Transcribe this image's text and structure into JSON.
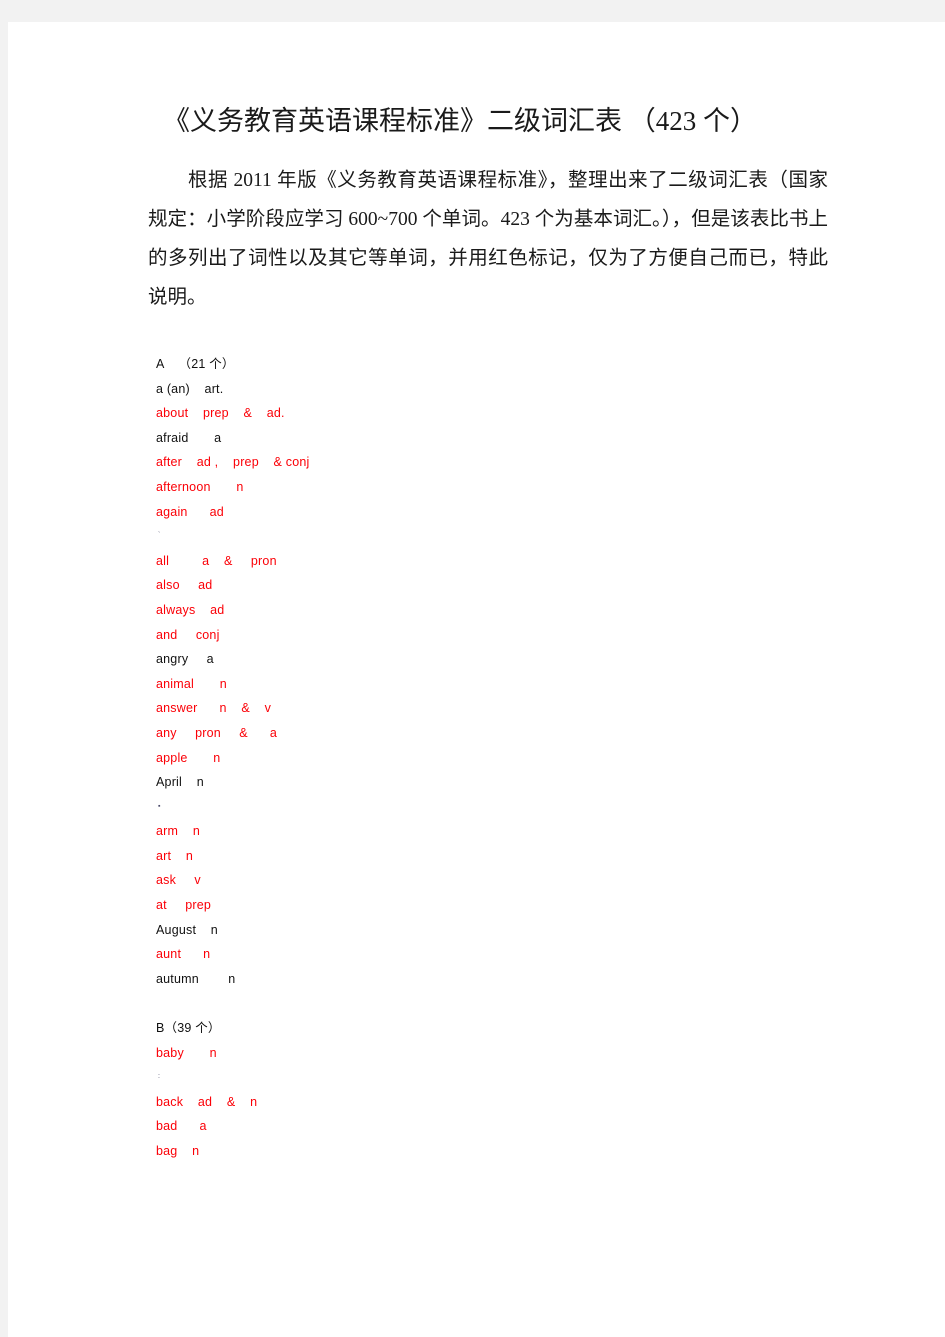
{
  "document": {
    "title_cn_open": "《义务教育英语课程标准》二级词汇表 （",
    "title_count": "423",
    "title_cn_close": " 个）",
    "title_full": "《义务教育英语课程标准》二级词汇表 （423 个）",
    "intro_paragraph": "根据 2011 年版《义务教育英语课程标准》，整理出来了二级词汇表（国家规定：小学阶段应学习 600~700 个单词。423 个为基本词汇。），但是该表比书上的多列出了词性以及其它等单词，并用红色标记，仅为了方便自己而已，特此说明。",
    "intro_segments": {
      "s1": "根据 ",
      "n1": "2011",
      "s2": " 年版《义务教育英语课程标准》，整理出来了二级词汇表（国家规定：小学阶段应学习 ",
      "n2": "600~700",
      "s3": " 个单词。",
      "n3": "423",
      "s4": " 个为基本词汇。），但是该表比书上的多列出了词性以及其它等单词，并用红色标记，仅为了方便自己而已，特此说明。"
    }
  },
  "colors": {
    "page_background": "#ffffff",
    "canvas_background": "#f2f2f2",
    "text_black": "#111111",
    "text_red": "#fb0007",
    "title_color": "#1a1a1a"
  },
  "sections": [
    {
      "id": "A",
      "heading": "A    （21 个）",
      "letter": "A",
      "count": "21",
      "entries": [
        {
          "text": "a (an)    art.",
          "word": "a (an)",
          "pos": "art.",
          "color": "black"
        },
        {
          "text": "about    prep    &    ad.",
          "word": "about",
          "pos": "prep  &  ad.",
          "color": "red"
        },
        {
          "text": "afraid       a",
          "word": "afraid",
          "pos": "a",
          "color": "black"
        },
        {
          "text": "after    ad ,    prep    & conj",
          "word": "after",
          "pos": "ad , prep & conj",
          "color": "red"
        },
        {
          "text": "afternoon       n",
          "word": "afternoon",
          "pos": "n",
          "color": "red"
        },
        {
          "text": "again      ad",
          "word": "again",
          "pos": "ad",
          "color": "red"
        },
        {
          "text": "`",
          "word": "",
          "pos": "",
          "color": "artifact"
        },
        {
          "text": "all         a    &     pron",
          "word": "all",
          "pos": "a & pron",
          "color": "red"
        },
        {
          "text": "also     ad",
          "word": "also",
          "pos": "ad",
          "color": "red"
        },
        {
          "text": "always    ad",
          "word": "always",
          "pos": "ad",
          "color": "red"
        },
        {
          "text": "and     conj",
          "word": "and",
          "pos": "conj",
          "color": "red"
        },
        {
          "text": "angry     a",
          "word": "angry",
          "pos": "a",
          "color": "black"
        },
        {
          "text": "animal       n",
          "word": "animal",
          "pos": "n",
          "color": "red"
        },
        {
          "text": "answer      n    &    v",
          "word": "answer",
          "pos": "n & v",
          "color": "red"
        },
        {
          "text": "any     pron     &      a",
          "word": "any",
          "pos": "pron & a",
          "color": "red"
        },
        {
          "text": "apple       n",
          "word": "apple",
          "pos": "n",
          "color": "red"
        },
        {
          "text": "April    n",
          "word": "April",
          "pos": "n",
          "color": "black"
        },
        {
          "text": "▪",
          "word": "",
          "pos": "",
          "color": "artifact"
        },
        {
          "text": "arm    n",
          "word": "arm",
          "pos": "n",
          "color": "red"
        },
        {
          "text": "art    n",
          "word": "art",
          "pos": "n",
          "color": "red"
        },
        {
          "text": "ask     v",
          "word": "ask",
          "pos": "v",
          "color": "red"
        },
        {
          "text": "at     prep",
          "word": "at",
          "pos": "prep",
          "color": "red"
        },
        {
          "text": "August    n",
          "word": "August",
          "pos": "n",
          "color": "black"
        },
        {
          "text": "aunt      n",
          "word": "aunt",
          "pos": "n",
          "color": "red"
        },
        {
          "text": "autumn        n",
          "word": "autumn",
          "pos": "n",
          "color": "black"
        }
      ]
    },
    {
      "id": "B",
      "heading": "B（39 个）",
      "letter": "B",
      "count": "39",
      "entries": [
        {
          "text": "baby       n",
          "word": "baby",
          "pos": "n",
          "color": "red"
        },
        {
          "text": ":",
          "word": "",
          "pos": "",
          "color": "artifact"
        },
        {
          "text": "back    ad    &    n",
          "word": "back",
          "pos": "ad & n",
          "color": "red"
        },
        {
          "text": "bad      a",
          "word": "bad",
          "pos": "a",
          "color": "red"
        },
        {
          "text": "bag    n",
          "word": "bag",
          "pos": "n",
          "color": "red"
        }
      ]
    }
  ]
}
